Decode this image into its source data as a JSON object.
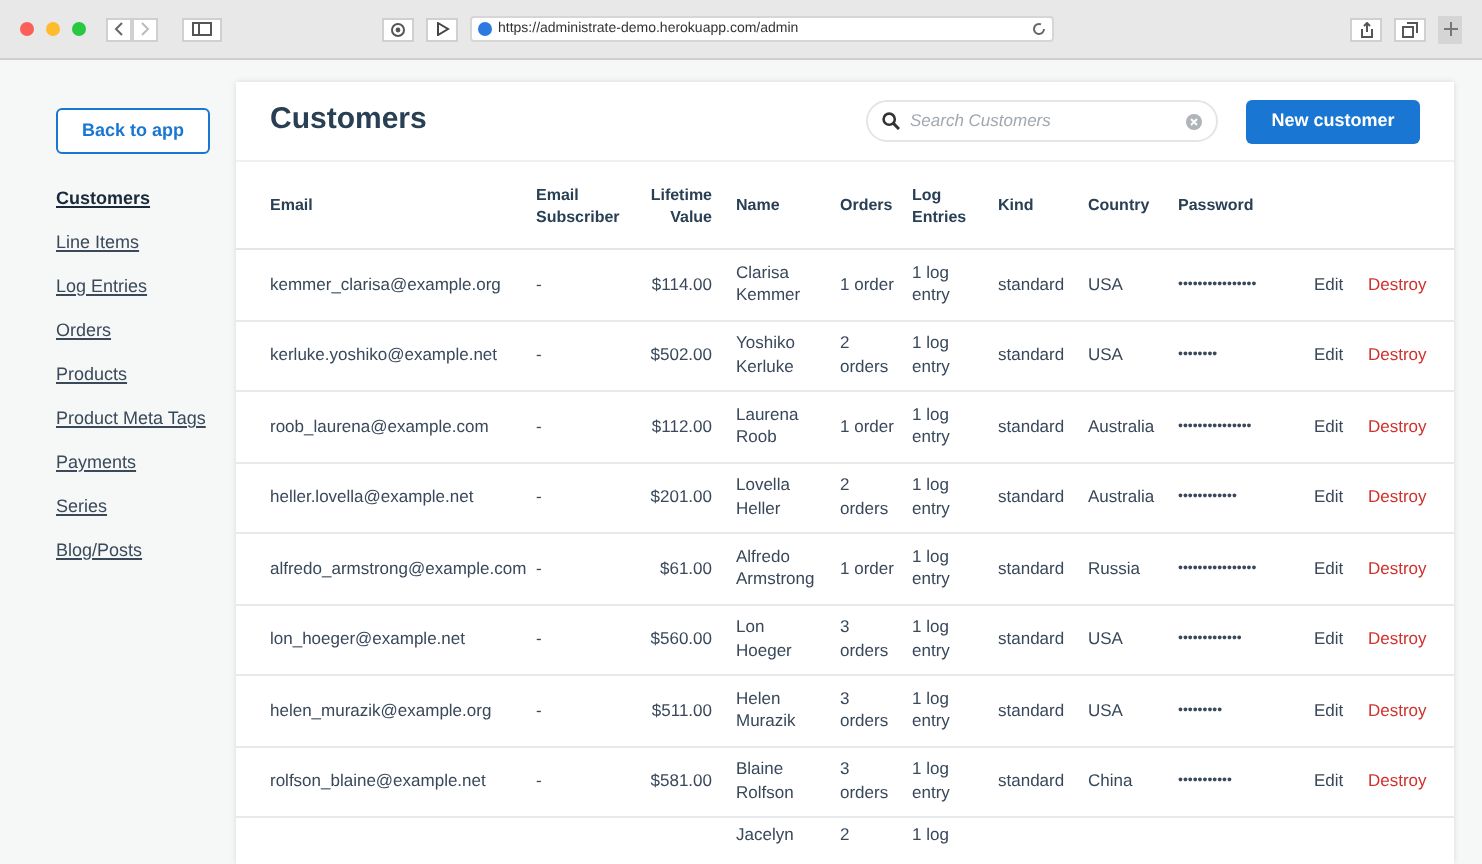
{
  "browser": {
    "url": "https://administrate-demo.herokuapp.com/admin"
  },
  "sidebar": {
    "back_button": "Back to app",
    "items": [
      {
        "label": "Customers",
        "selected": true
      },
      {
        "label": "Line Items",
        "selected": false
      },
      {
        "label": "Log Entries",
        "selected": false
      },
      {
        "label": "Orders",
        "selected": false
      },
      {
        "label": "Products",
        "selected": false
      },
      {
        "label": "Product Meta Tags",
        "selected": false
      },
      {
        "label": "Payments",
        "selected": false
      },
      {
        "label": "Series",
        "selected": false
      },
      {
        "label": "Blog/Posts",
        "selected": false
      }
    ]
  },
  "header": {
    "title": "Customers",
    "search": {
      "placeholder": "Search Customers"
    },
    "new_button": "New customer"
  },
  "table": {
    "columns": [
      "Email",
      "Email Subscriber",
      "Lifetime Value",
      "Name",
      "Orders",
      "Log Entries",
      "Kind",
      "Country",
      "Password"
    ],
    "rows": [
      {
        "email": "kemmer_clarisa@example.org",
        "subscriber": "-",
        "value": "$114.00",
        "name": "Clarisa Kemmer",
        "orders": "1 order",
        "log": "1 log entry",
        "kind": "standard",
        "country": "USA",
        "password": "••••••••••••••••",
        "edit": "Edit",
        "destroy": "Destroy"
      },
      {
        "email": "kerluke.yoshiko@example.net",
        "subscriber": "-",
        "value": "$502.00",
        "name": "Yoshiko Kerluke",
        "orders": "2 orders",
        "log": "1 log entry",
        "kind": "standard",
        "country": "USA",
        "password": "••••••••",
        "edit": "Edit",
        "destroy": "Destroy"
      },
      {
        "email": "roob_laurena@example.com",
        "subscriber": "-",
        "value": "$112.00",
        "name": "Laurena Roob",
        "orders": "1 order",
        "log": "1 log entry",
        "kind": "standard",
        "country": "Australia",
        "password": "•••••••••••••••",
        "edit": "Edit",
        "destroy": "Destroy"
      },
      {
        "email": "heller.lovella@example.net",
        "subscriber": "-",
        "value": "$201.00",
        "name": "Lovella Heller",
        "orders": "2 orders",
        "log": "1 log entry",
        "kind": "standard",
        "country": "Australia",
        "password": "••••••••••••",
        "edit": "Edit",
        "destroy": "Destroy"
      },
      {
        "email": "alfredo_armstrong@example.com",
        "subscriber": "-",
        "value": "$61.00",
        "name": "Alfredo Armstrong",
        "orders": "1 order",
        "log": "1 log entry",
        "kind": "standard",
        "country": "Russia",
        "password": "••••••••••••••••",
        "edit": "Edit",
        "destroy": "Destroy"
      },
      {
        "email": "lon_hoeger@example.net",
        "subscriber": "-",
        "value": "$560.00",
        "name": "Lon Hoeger",
        "orders": "3 orders",
        "log": "1 log entry",
        "kind": "standard",
        "country": "USA",
        "password": "•••••••••••••",
        "edit": "Edit",
        "destroy": "Destroy"
      },
      {
        "email": "helen_murazik@example.org",
        "subscriber": "-",
        "value": "$511.00",
        "name": "Helen Murazik",
        "orders": "3 orders",
        "log": "1 log entry",
        "kind": "standard",
        "country": "USA",
        "password": "•••••••••",
        "edit": "Edit",
        "destroy": "Destroy"
      },
      {
        "email": "rolfson_blaine@example.net",
        "subscriber": "-",
        "value": "$581.00",
        "name": "Blaine Rolfson",
        "orders": "3 orders",
        "log": "1 log entry",
        "kind": "standard",
        "country": "China",
        "password": "•••••••••••",
        "edit": "Edit",
        "destroy": "Destroy"
      },
      {
        "name": "Jacelyn",
        "orders": "2",
        "log": "1 log"
      }
    ]
  }
}
